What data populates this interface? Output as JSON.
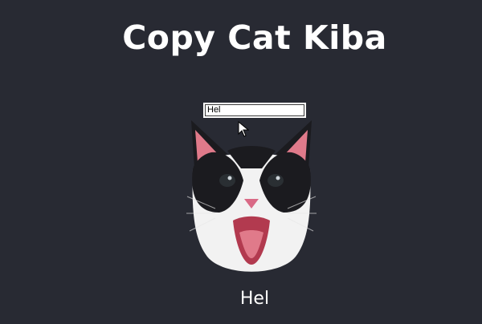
{
  "page": {
    "title": "Copy Cat Kiba",
    "background_color": "#282a33"
  },
  "input": {
    "value": "Hel"
  },
  "echo": {
    "text": "Hel"
  },
  "image": {
    "subject": "cat-photo"
  },
  "cursor": {
    "icon": "arrow-pointer"
  }
}
